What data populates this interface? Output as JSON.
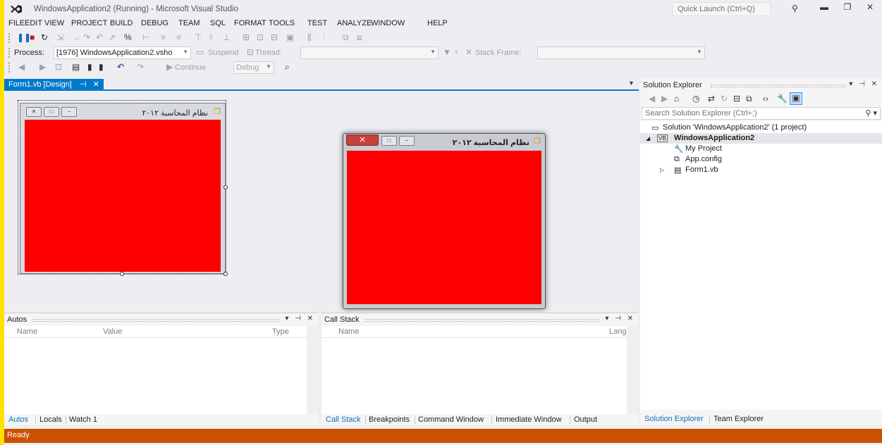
{
  "window": {
    "title": "WindowsApplication2 (Running) - Microsoft Visual Studio",
    "quick_launch_placeholder": "Quick Launch (Ctrl+Q)"
  },
  "menu": [
    "FILE",
    "EDIT",
    "VIEW",
    "PROJECT",
    "BUILD",
    "DEBUG",
    "TEAM",
    "SQL",
    "FORMAT",
    "TOOLS",
    "TEST",
    "ANALYZE",
    "WINDOW",
    "HELP"
  ],
  "debug_toolbar": {
    "process_label": "Process:",
    "process_value": "[1976] WindowsApplication2.vsho",
    "suspend_label": "Suspend",
    "thread_label": "Thread:",
    "stack_frame_label": "Stack Frame:",
    "continue_label": "Continue",
    "config_value": "Debug"
  },
  "document_tab": {
    "label": "Form1.vb [Design]",
    "pin": "⊣",
    "close": "✕"
  },
  "form": {
    "caption": "نظام المحاسبة ٢٠١٢",
    "client_color": "#ff0000"
  },
  "autos_panel": {
    "title": "Autos",
    "columns": [
      "Name",
      "Value",
      "Type"
    ],
    "tabs": [
      "Autos",
      "Locals",
      "Watch 1"
    ]
  },
  "call_stack_panel": {
    "title": "Call Stack",
    "columns": [
      "Name",
      "Lang"
    ],
    "tabs": [
      "Call Stack",
      "Breakpoints",
      "Command Window",
      "Immediate Window",
      "Output"
    ]
  },
  "solution_explorer": {
    "title": "Solution Explorer",
    "search_placeholder": "Search Solution Explorer (Ctrl+;)",
    "tree": [
      {
        "label": "Solution 'WindowsApplication2' (1 project)",
        "icon": "solution-icon"
      },
      {
        "label": "WindowsApplication2",
        "icon": "vb-project-icon"
      },
      {
        "label": "My Project",
        "icon": "wrench-icon"
      },
      {
        "label": "App.config",
        "icon": "config-icon"
      },
      {
        "label": "Form1.vb",
        "icon": "form-icon"
      }
    ],
    "tabs": [
      "Solution Explorer",
      "Team Explorer"
    ]
  },
  "status": {
    "text": "Ready",
    "color": "#ca5100"
  },
  "colors": {
    "accent": "#007acc",
    "status_bar": "#ca5100"
  }
}
